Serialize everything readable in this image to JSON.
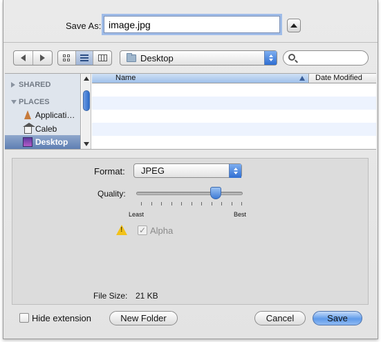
{
  "save_as": {
    "label": "Save As:",
    "filename": "image.jpg"
  },
  "toolbar": {
    "back_icon": "chevron-left-icon",
    "forward_icon": "chevron-right-icon",
    "views": [
      "icon-view",
      "list-view",
      "column-view"
    ],
    "selected_view": "list-view",
    "location": "Desktop",
    "search_placeholder": ""
  },
  "sidebar": {
    "sections": [
      {
        "label": "SHARED",
        "expanded": false
      },
      {
        "label": "PLACES",
        "expanded": true
      }
    ],
    "items": [
      {
        "label": "Applicati…",
        "icon": "applications-icon",
        "selected": false
      },
      {
        "label": "Caleb",
        "icon": "home-icon",
        "selected": false
      },
      {
        "label": "Desktop",
        "icon": "desktop-icon",
        "selected": true
      }
    ]
  },
  "file_list": {
    "columns": [
      "Name",
      "Date Modified"
    ],
    "sort_column": "Name",
    "rows": []
  },
  "options": {
    "format_label": "Format:",
    "format_value": "JPEG",
    "quality_label": "Quality:",
    "quality_value": 0.77,
    "least_label": "Least",
    "best_label": "Best",
    "alpha_label": "Alpha",
    "alpha_checked": true,
    "alpha_enabled": false,
    "file_size_label": "File Size:",
    "file_size_value": "21 KB"
  },
  "footer": {
    "hide_extension_label": "Hide extension",
    "hide_extension_checked": false,
    "new_folder_label": "New Folder",
    "cancel_label": "Cancel",
    "save_label": "Save"
  },
  "colors": {
    "accent": "#3d7bd6",
    "sidebar_bg": "#dfe5ed",
    "row_alt": "#edf3fe"
  }
}
